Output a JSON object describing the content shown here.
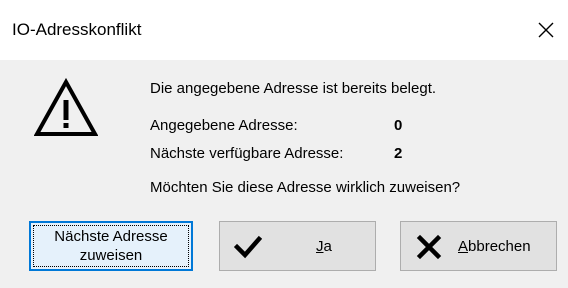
{
  "window": {
    "title": "IO-Adresskonflikt",
    "close_icon": "close-icon"
  },
  "message": {
    "main": "Die angegebene Adresse ist bereits belegt.",
    "given_label": "Angegebene Adresse:",
    "given_value": "0",
    "next_label": "Nächste verfügbare Adresse:",
    "next_value": "2",
    "question": "Möchten Sie diese Adresse wirklich zuweisen?",
    "icon": "warning-icon"
  },
  "buttons": {
    "next_line1": "Nächste Adresse",
    "next_line2": "zuweisen",
    "yes_mnemonic": "J",
    "yes_rest": "a",
    "yes_icon": "checkmark-icon",
    "cancel_mnemonic": "A",
    "cancel_rest": "bbrechen",
    "cancel_icon": "x-icon"
  },
  "colors": {
    "content_bg": "#f0f0f0",
    "titlebar_bg": "#ffffff",
    "button_bg": "#e1e1e1",
    "focus_border": "#0078d7",
    "focus_bg": "#e5f1fb"
  }
}
